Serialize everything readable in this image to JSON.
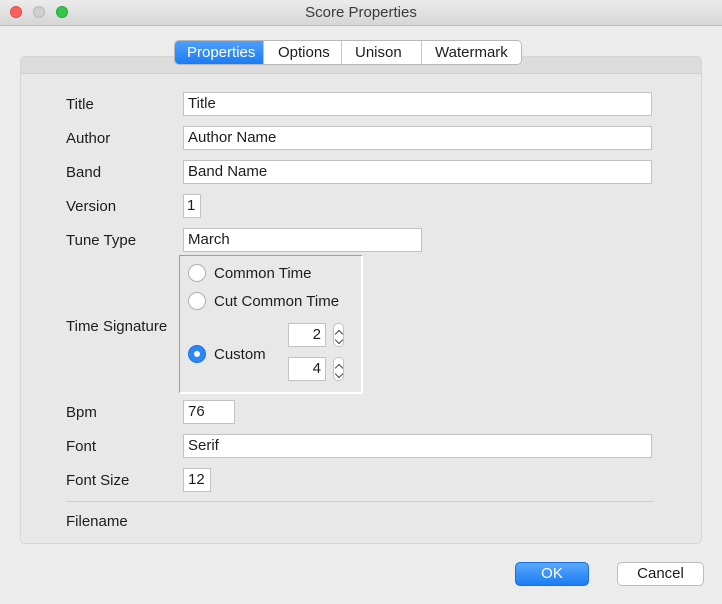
{
  "window": {
    "title": "Score Properties"
  },
  "tabs": [
    {
      "label": "Properties",
      "active": true
    },
    {
      "label": "Options",
      "active": false
    },
    {
      "label": "Unison",
      "active": false
    },
    {
      "label": "Watermark",
      "active": false
    }
  ],
  "form": {
    "title": {
      "label": "Title",
      "value": "Title"
    },
    "author": {
      "label": "Author",
      "value": "Author Name"
    },
    "band": {
      "label": "Band",
      "value": "Band Name"
    },
    "version": {
      "label": "Version",
      "value": "1"
    },
    "tune_type": {
      "label": "Tune Type",
      "value": "March"
    },
    "time_signature": {
      "label": "Time Signature",
      "options": [
        "Common Time",
        "Cut Common Time",
        "Custom"
      ],
      "selected": "Custom",
      "numerator": "2",
      "denominator": "4"
    },
    "bpm": {
      "label": "Bpm",
      "value": "76"
    },
    "font": {
      "label": "Font",
      "value": "Serif"
    },
    "font_size": {
      "label": "Font Size",
      "value": "12"
    },
    "filename": {
      "label": "Filename",
      "value": ""
    }
  },
  "buttons": {
    "ok": "OK",
    "cancel": "Cancel"
  },
  "colors": {
    "accent": "#1a7cf3",
    "close": "#fc605c",
    "maximize": "#34c749"
  }
}
